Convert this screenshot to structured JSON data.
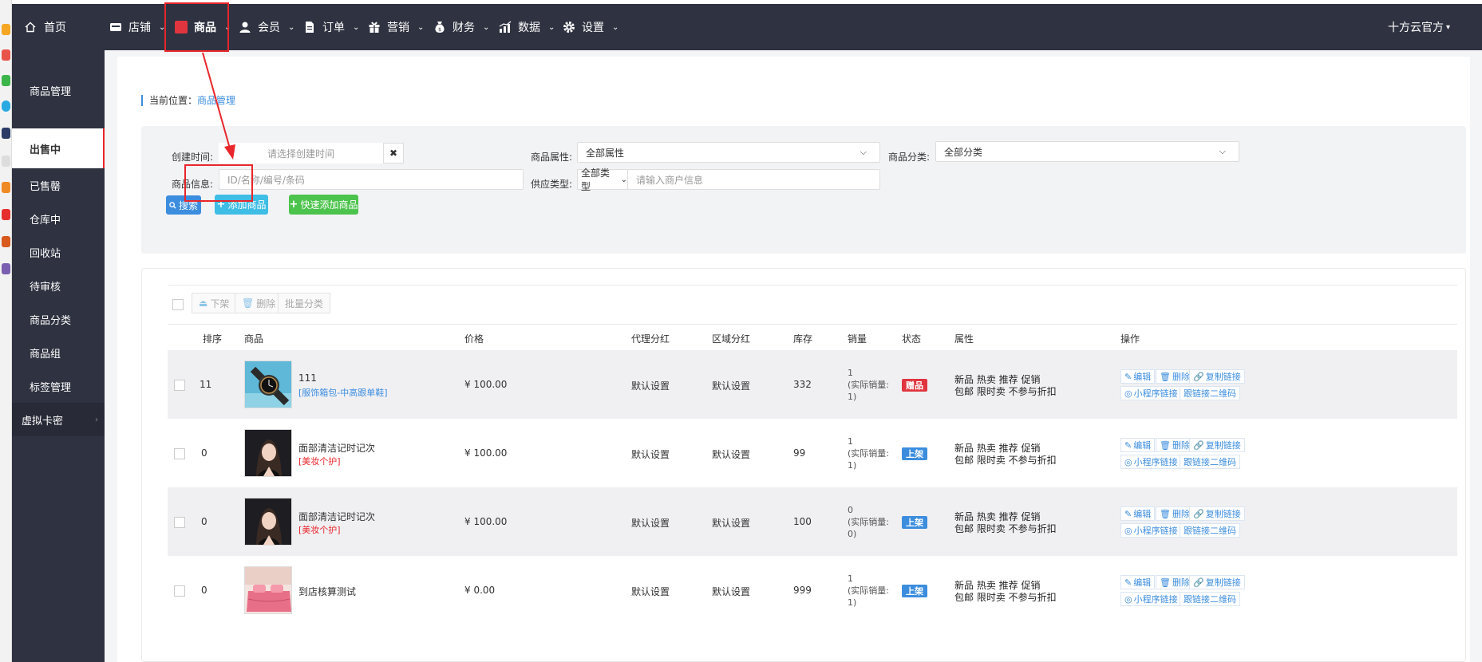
{
  "topnav": {
    "home_label": "首页",
    "items": [
      {
        "label": "店铺",
        "icon": "store-icon"
      },
      {
        "label": "商品",
        "icon": "goods-icon"
      },
      {
        "label": "会员",
        "icon": "member-icon"
      },
      {
        "label": "订单",
        "icon": "order-icon"
      },
      {
        "label": "营销",
        "icon": "marketing-icon"
      },
      {
        "label": "财务",
        "icon": "finance-icon"
      },
      {
        "label": "数据",
        "icon": "data-icon"
      },
      {
        "label": "设置",
        "icon": "settings-icon"
      }
    ],
    "user_label": "十方云官方",
    "active_color": "#e0353e",
    "bg_color": "#2f3240"
  },
  "sidebar": {
    "items": [
      {
        "label": "商品管理"
      },
      {
        "label": "出售中"
      },
      {
        "label": "已售罄"
      },
      {
        "label": "仓库中"
      },
      {
        "label": "回收站"
      },
      {
        "label": "待审核"
      },
      {
        "label": "商品分类"
      },
      {
        "label": "商品组"
      },
      {
        "label": "标签管理"
      },
      {
        "label": "虚拟卡密"
      }
    ]
  },
  "breadcrumb": {
    "prefix": "当前位置：",
    "current": "商品管理"
  },
  "filters": {
    "create_time_label": "创建时间:",
    "create_time_placeholder": "请选择创建时间",
    "clear_label": "✖",
    "attr_label": "商品属性:",
    "attr_value": "全部属性",
    "category_label": "商品分类:",
    "category_value": "全部分类",
    "info_label": "商品信息:",
    "info_placeholder": "ID/名称/编号/条码",
    "supply_label": "供应类型:",
    "supply_value": "全部类型",
    "merchant_placeholder": "请输入商户信息",
    "search_btn": "搜索",
    "add_btn": "添加商品",
    "quick_add_btn": "快速添加商品"
  },
  "toolbar": {
    "offshelf": "下架",
    "delete": "删除",
    "batch_category": "批量分类"
  },
  "table": {
    "headers": [
      "排序",
      "商品",
      "价格",
      "代理分红",
      "区域分红",
      "库存",
      "销量",
      "状态",
      "属性",
      "操作"
    ],
    "rows": [
      {
        "sort": "11",
        "name": "111",
        "category": "[服饰箱包-中高跟单鞋]",
        "category_color": "#3c8dde",
        "price": "¥ 100.00",
        "agent": "默认设置",
        "region": "默认设置",
        "stock": "332",
        "sales_1": "1",
        "sales_2": "(实际销量:",
        "sales_3": "1)",
        "status": "赠品",
        "status_color": "#e0353e",
        "attr_1": "新品 热卖 推荐 促销",
        "attr_2": "包邮 限时卖 不参与折扣",
        "thumb": "watch"
      },
      {
        "sort": "0",
        "name": "面部清洁记时记次",
        "category": "[美妆个护]",
        "category_color": "#e8262b",
        "price": "¥ 100.00",
        "agent": "默认设置",
        "region": "默认设置",
        "stock": "99",
        "sales_1": "1",
        "sales_2": "(实际销量:",
        "sales_3": "1)",
        "status": "上架",
        "status_color": "#3c8dde",
        "attr_1": "新品 热卖 推荐 促销",
        "attr_2": "包邮 限时卖 不参与折扣",
        "thumb": "portrait"
      },
      {
        "sort": "0",
        "name": "面部清洁记时记次",
        "category": "[美妆个护]",
        "category_color": "#e8262b",
        "price": "¥ 100.00",
        "agent": "默认设置",
        "region": "默认设置",
        "stock": "100",
        "sales_1": "0",
        "sales_2": "(实际销量:",
        "sales_3": "0)",
        "status": "上架",
        "status_color": "#3c8dde",
        "attr_1": "新品 热卖 推荐 促销",
        "attr_2": "包邮 限时卖 不参与折扣",
        "thumb": "portrait"
      },
      {
        "sort": "0",
        "name": "到店核算测试",
        "category": "",
        "category_color": "#3c8dde",
        "price": "¥ 0.00",
        "agent": "默认设置",
        "region": "默认设置",
        "stock": "999",
        "sales_1": "1",
        "sales_2": "(实际销量:",
        "sales_3": "1)",
        "status": "上架",
        "status_color": "#3c8dde",
        "attr_1": "新品 热卖 推荐 促销",
        "attr_2": "包邮 限时卖 不参与折扣",
        "thumb": "bedding"
      }
    ],
    "ops": {
      "edit": "编辑",
      "delete": "删除",
      "copy_link": "复制链接",
      "mini_link": "小程序链接",
      "qrcode": "跟链接二维码"
    }
  }
}
